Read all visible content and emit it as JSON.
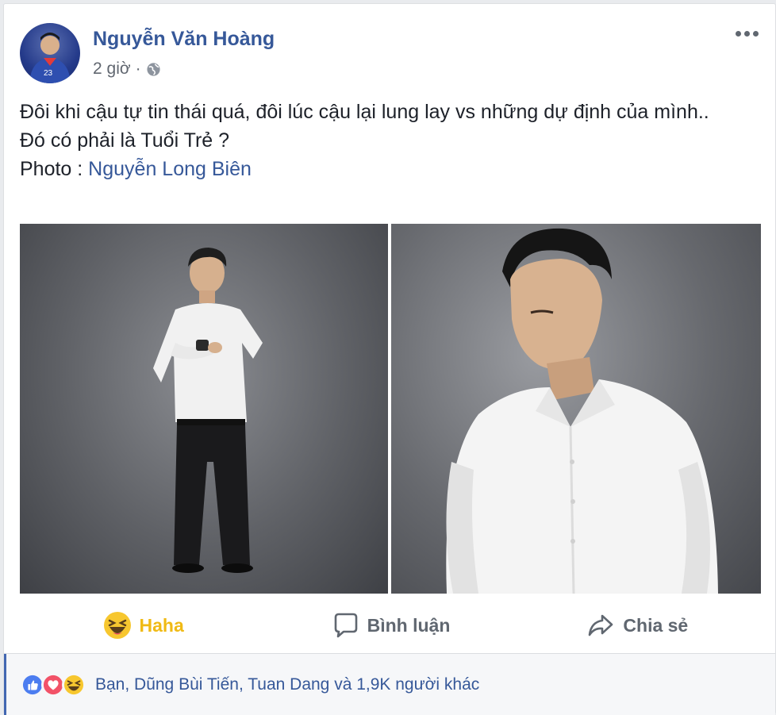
{
  "post": {
    "author": "Nguyễn Văn Hoàng",
    "time": "2 giờ",
    "separator": "·",
    "privacy_icon": "globe-icon",
    "text_line1": "Đôi khi cậu tự tin thái quá, đôi lúc cậu lại lung lay vs những dự định của mình..",
    "text_line2": "Đó có phải là Tuổi Trẻ ?",
    "photo_prefix": "Photo : ",
    "photo_credit": "Nguyễn Long Biên"
  },
  "actions": {
    "haha_label": "Haha",
    "comment_label": "Bình luận",
    "share_label": "Chia sẻ"
  },
  "reactions": {
    "icons": [
      "like-icon",
      "love-icon",
      "haha-icon"
    ],
    "summary": "Bạn, Dũng Bùi Tiến, Tuan Dang và 1,9K người khác"
  },
  "colors": {
    "link": "#365899",
    "haha": "#f0ba15",
    "muted": "#606770",
    "like": "#4c7df0",
    "love": "#f25268"
  }
}
